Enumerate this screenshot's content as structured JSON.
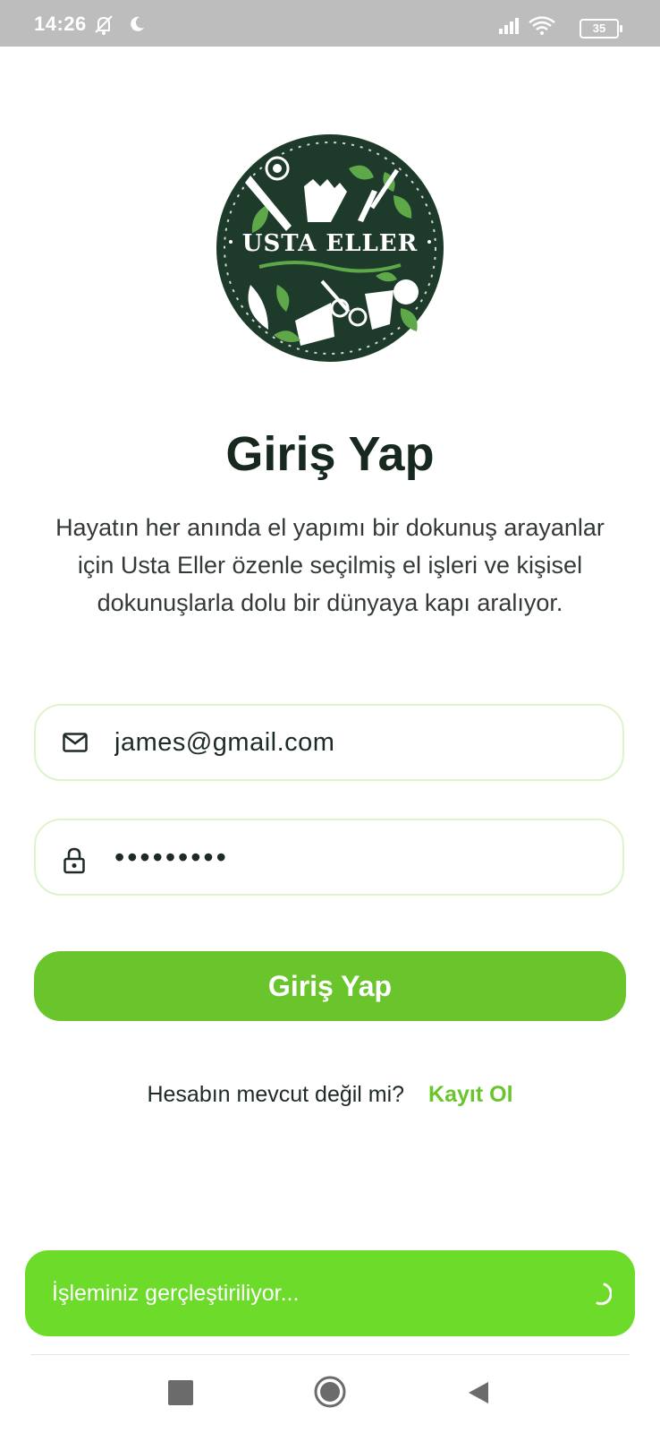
{
  "status_bar": {
    "time": "14:26",
    "battery": "35",
    "icons": [
      "silent-mode-icon",
      "moon-icon",
      "signal-icon",
      "wifi-icon",
      "battery-icon"
    ]
  },
  "logo": {
    "text": "USTA ELLER",
    "colors": {
      "background": "#1e3a2b",
      "leaf": "#5fa84a",
      "ink": "#ffffff"
    }
  },
  "login": {
    "title": "Giriş Yap",
    "description": "Hayatın her anında el yapımı bir dokunuş arayanlar için Usta Eller özenle seçilmiş el işleri ve kişisel dokunuşlarla dolu bir dünyaya kapı aralıyor.",
    "email": {
      "value": "james@gmail.com",
      "icon": "mail-icon"
    },
    "password": {
      "value": "•••••••••",
      "icon": "lock-icon"
    },
    "button_label": "Giriş Yap",
    "signup_question": "Hesabın mevcut değil mi?",
    "signup_link": "Kayıt Ol"
  },
  "snackbar": {
    "message": "İşleminiz gerçleştiriliyor..."
  },
  "nav_bar": {
    "buttons": [
      "recents-button",
      "home-button",
      "back-button"
    ]
  },
  "theme": {
    "accent": "#6ac52c",
    "snackbar_bg": "#6ddb2a",
    "field_border": "#dcf3cc",
    "title_color": "#17291f"
  }
}
